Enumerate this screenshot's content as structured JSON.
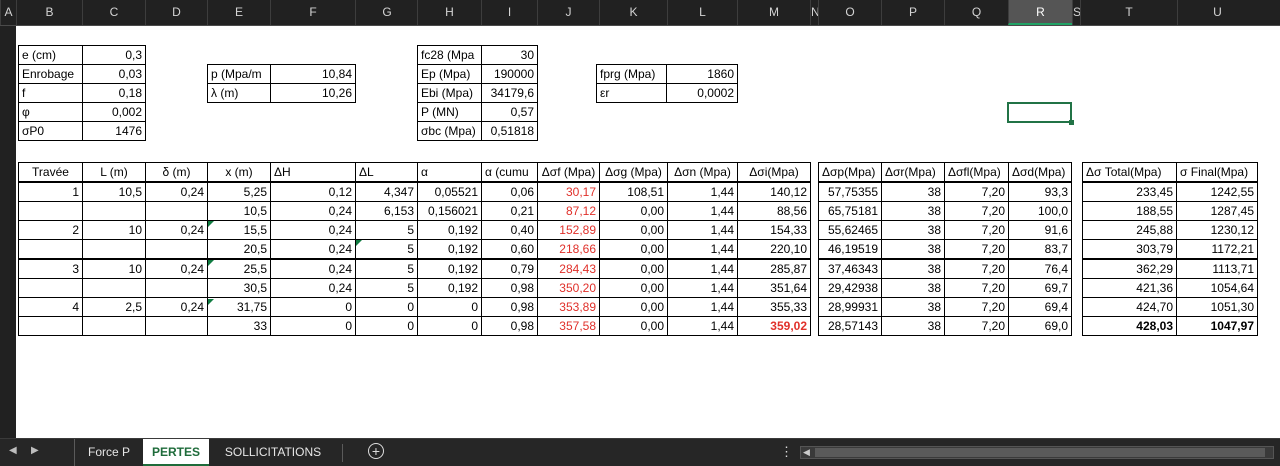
{
  "column_headers": [
    "A",
    "B",
    "C",
    "D",
    "E",
    "F",
    "G",
    "H",
    "I",
    "J",
    "K",
    "L",
    "M",
    "N",
    "O",
    "P",
    "Q",
    "R",
    "S",
    "T",
    "U"
  ],
  "selected_column": "R",
  "params_block_1": {
    "rows": [
      {
        "label": "e (cm)",
        "value": "0,3"
      },
      {
        "label": "Enrobage",
        "value": "0,03"
      },
      {
        "label": "f",
        "value": "0,18"
      },
      {
        "label": "φ",
        "value": "0,002"
      },
      {
        "label": "σP0",
        "value": "1476"
      }
    ]
  },
  "params_block_2": {
    "rows": [
      {
        "label": "p (Mpa/m",
        "value": "10,84"
      },
      {
        "label": "λ (m)",
        "value": "10,26"
      }
    ]
  },
  "params_block_3": {
    "rows": [
      {
        "label": "fc28 (Mpa",
        "value": "30"
      },
      {
        "label": "Ep (Mpa)",
        "value": "190000"
      },
      {
        "label": "Ebi (Mpa)",
        "value": "34179,6"
      },
      {
        "label": "P (MN)",
        "value": "0,57"
      },
      {
        "label": "σbc (Mpa)",
        "value": "0,51818"
      }
    ]
  },
  "params_block_4": {
    "rows": [
      {
        "label": "fprg (Mpa)",
        "value": "1860"
      },
      {
        "label": "εr",
        "value": "0,0002"
      }
    ]
  },
  "table_main": {
    "headers": [
      "Travée",
      "L (m)",
      "δ (m)",
      "x  (m)",
      "ΔH",
      "ΔL",
      "α",
      "α (cumu",
      "Δσf (Mpa)",
      "Δσg (Mpa)",
      "Δσn (Mpa)",
      "Δσi(Mpa)"
    ],
    "rows": [
      [
        "1",
        "10,5",
        "0,24",
        "5,25",
        "0,12",
        "4,347",
        "0,05521",
        "0,06",
        "30,17",
        "108,51",
        "1,44",
        "140,12"
      ],
      [
        "",
        "",
        "",
        "10,5",
        "0,24",
        "6,153",
        "0,156021",
        "0,21",
        "87,12",
        "0,00",
        "1,44",
        "88,56"
      ],
      [
        "2",
        "10",
        "0,24",
        "15,5",
        "0,24",
        "5",
        "0,192",
        "0,40",
        "152,89",
        "0,00",
        "1,44",
        "154,33"
      ],
      [
        "",
        "",
        "",
        "20,5",
        "0,24",
        "5",
        "0,192",
        "0,60",
        "218,66",
        "0,00",
        "1,44",
        "220,10"
      ],
      [
        "3",
        "10",
        "0,24",
        "25,5",
        "0,24",
        "5",
        "0,192",
        "0,79",
        "284,43",
        "0,00",
        "1,44",
        "285,87"
      ],
      [
        "",
        "",
        "",
        "30,5",
        "0,24",
        "5",
        "0,192",
        "0,98",
        "350,20",
        "0,00",
        "1,44",
        "351,64"
      ],
      [
        "4",
        "2,5",
        "0,24",
        "31,75",
        "0",
        "0",
        "0",
        "0,98",
        "353,89",
        "0,00",
        "1,44",
        "355,33"
      ],
      [
        "",
        "",
        "",
        "33",
        "0",
        "0",
        "0",
        "0,98",
        "357,58",
        "0,00",
        "1,44",
        "359,02"
      ]
    ]
  },
  "table_delayed": {
    "headers": [
      "Δσp(Mpa)",
      "Δσr(Mpa)",
      "Δσfl(Mpa)",
      "Δσd(Mpa)"
    ],
    "rows": [
      [
        "57,75355",
        "38",
        "7,20",
        "93,3"
      ],
      [
        "65,75181",
        "38",
        "7,20",
        "100,0"
      ],
      [
        "55,62465",
        "38",
        "7,20",
        "91,6"
      ],
      [
        "46,19519",
        "38",
        "7,20",
        "83,7"
      ],
      [
        "37,46343",
        "38",
        "7,20",
        "76,4"
      ],
      [
        "29,42938",
        "38",
        "7,20",
        "69,7"
      ],
      [
        "28,99931",
        "38",
        "7,20",
        "69,4"
      ],
      [
        "28,57143",
        "38",
        "7,20",
        "69,0"
      ]
    ]
  },
  "table_total": {
    "headers": [
      "Δσ Total(Mpa)",
      "σ Final(Mpa)"
    ],
    "rows": [
      [
        "233,45",
        "1242,55"
      ],
      [
        "188,55",
        "1287,45"
      ],
      [
        "245,88",
        "1230,12"
      ],
      [
        "303,79",
        "1172,21"
      ],
      [
        "362,29",
        "1113,71"
      ],
      [
        "421,36",
        "1054,64"
      ],
      [
        "424,70",
        "1051,30"
      ],
      [
        "428,03",
        "1047,97"
      ]
    ]
  },
  "sheet_tabs": {
    "tabs": [
      "Force P",
      "PERTES",
      "SOLLICITATIONS"
    ],
    "active": "PERTES"
  },
  "colors": {
    "accent_green": "#217346",
    "red_values": "#e0302a",
    "header_dark": "#212121"
  }
}
